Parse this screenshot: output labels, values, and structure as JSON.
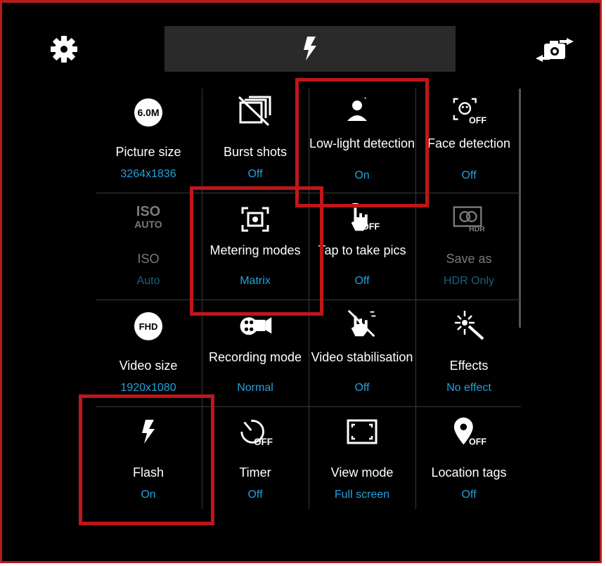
{
  "top": {
    "settings_icon": "gear-icon",
    "flash_icon": "flash-icon",
    "switch_camera_icon": "switch-camera-icon"
  },
  "badges": {
    "picture_size": "6.0M",
    "iso_top": "ISO",
    "iso_bottom": "AUTO",
    "video_size": "FHD",
    "off": "OFF",
    "hdr": "HDR"
  },
  "settings": [
    {
      "label": "Picture size",
      "value": "3264x1836",
      "icon": "picture-size-icon"
    },
    {
      "label": "Burst shots",
      "value": "Off",
      "icon": "burst-shots-icon"
    },
    {
      "label": "Low-light detection",
      "value": "On",
      "icon": "low-light-icon"
    },
    {
      "label": "Face detection",
      "value": "Off",
      "icon": "face-detection-icon"
    },
    {
      "label": "ISO",
      "value": "Auto",
      "icon": "iso-icon"
    },
    {
      "label": "Metering modes",
      "value": "Matrix",
      "icon": "metering-icon"
    },
    {
      "label": "Tap to take pics",
      "value": "Off",
      "icon": "tap-icon"
    },
    {
      "label": "Save as",
      "value": "HDR Only",
      "icon": "hdr-icon"
    },
    {
      "label": "Video size",
      "value": "1920x1080",
      "icon": "video-size-icon"
    },
    {
      "label": "Recording mode",
      "value": "Normal",
      "icon": "recording-mode-icon"
    },
    {
      "label": "Video stabilisation",
      "value": "Off",
      "icon": "stabilisation-icon"
    },
    {
      "label": "Effects",
      "value": "No effect",
      "icon": "effects-icon"
    },
    {
      "label": "Flash",
      "value": "On",
      "icon": "flash-icon"
    },
    {
      "label": "Timer",
      "value": "Off",
      "icon": "timer-icon"
    },
    {
      "label": "View mode",
      "value": "Full screen",
      "icon": "view-mode-icon"
    },
    {
      "label": "Location tags",
      "value": "Off",
      "icon": "location-tags-icon"
    }
  ],
  "colors": {
    "background": "#000000",
    "label": "#ffffff",
    "value": "#1fa3db",
    "highlight": "#c0161b"
  }
}
